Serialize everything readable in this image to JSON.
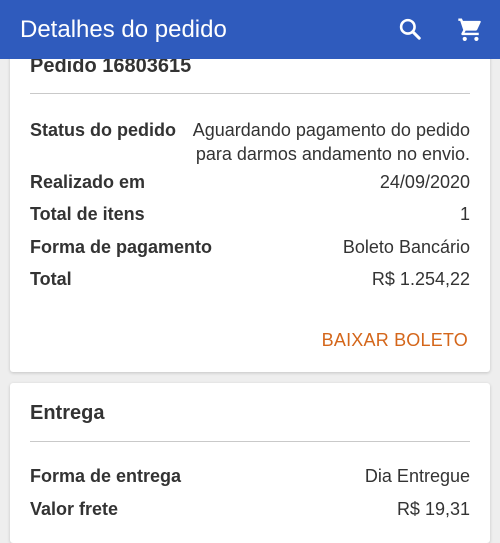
{
  "appbar": {
    "title": "Detalhes do pedido",
    "search_icon": "search-icon",
    "cart_icon": "cart-icon",
    "background": "#2f5bbd"
  },
  "order": {
    "title": "Pedido 16803615",
    "status_label": "Status do pedido",
    "status_value": "Aguardando pagamento do pedido para darmos andamento no envio.",
    "date_label": "Realizado em",
    "date_value": "24/09/2020",
    "items_label": "Total de itens",
    "items_value": "1",
    "payment_label": "Forma de pagamento",
    "payment_value": "Boleto Bancário",
    "total_label": "Total",
    "total_value": "R$ 1.254,22",
    "download_label": "BAIXAR BOLETO",
    "accent": "#d4661a"
  },
  "delivery": {
    "title": "Entrega",
    "method_label": "Forma de entrega",
    "method_value": "Dia Entregue",
    "freight_label": "Valor frete",
    "freight_value": "R$ 19,31"
  }
}
